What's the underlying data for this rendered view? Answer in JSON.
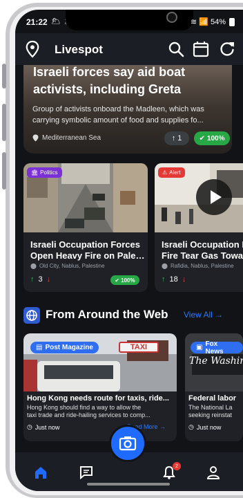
{
  "status_bar": {
    "time": "21:22",
    "left_icons": "🌥 🌥",
    "signal": "📶",
    "battery_text": "54%"
  },
  "app_bar": {
    "title": "Livespot",
    "icons": [
      "map-pin-icon",
      "search-icon",
      "calendar-icon",
      "refresh-icon"
    ]
  },
  "hero": {
    "title": "Israeli forces say aid boat activists, including Greta",
    "description": "Group of activists onboard the Madleen, which was carrying symbolic amount of food and supplies fo...",
    "location": "Mediterranean Sea",
    "votes": "1",
    "badge": "100%"
  },
  "news_cards": [
    {
      "category": "Politics",
      "category_color": "#7b2fd6",
      "title_line1": "Israeli Occupation Forces",
      "title_line2": "Open Heavy Fire on Pales...",
      "location": "Old City, Nablus, Palestine",
      "votes": "3",
      "badge": "100%"
    },
    {
      "category": "Alert",
      "category_color": "#e53935",
      "title_line1": "Israeli Occupation F",
      "title_line2": "Fire Tear Gas Towar",
      "location": "Rafidia, Nablus, Palestine",
      "votes": "18"
    }
  ],
  "web_section": {
    "title": "From Around the Web",
    "view_all": "View All →",
    "cards": [
      {
        "source": "Post Magazine",
        "title": "Hong Kong needs route for taxis, ride...",
        "desc_line1": "Hong Kong should find a way to allow the",
        "desc_line2": "taxi trade and ride-hailing services to comp...",
        "time": "Just now",
        "read_more": "Read More →",
        "image_text": "TAXI"
      },
      {
        "source": "Fox News",
        "title": "Federal labor",
        "desc_line1": "The National La",
        "desc_line2": "seeking reinstat",
        "time": "Just now",
        "image_text": "The Washington"
      }
    ]
  },
  "bottom_nav": {
    "items": [
      "home-icon",
      "messages-icon",
      "notifications-icon",
      "profile-icon"
    ],
    "notification_count": "2"
  },
  "colors": {
    "background": "#121317",
    "appbar": "#1c1e25",
    "accent": "#2979ff",
    "success": "#27a745"
  }
}
